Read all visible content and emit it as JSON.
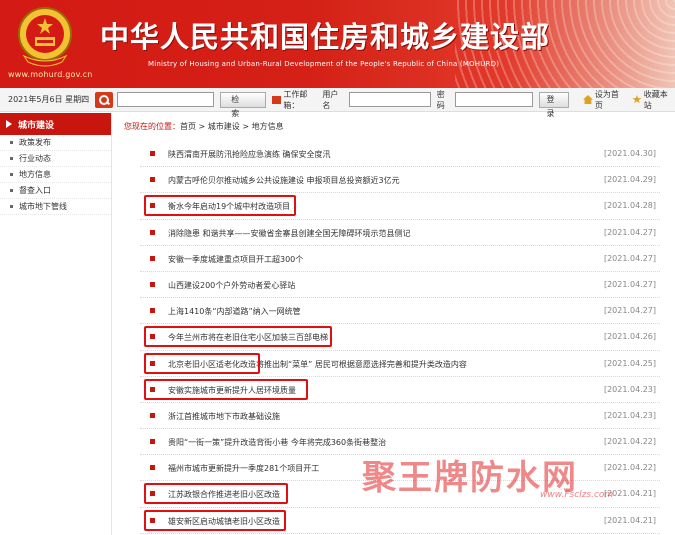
{
  "header": {
    "site_url": "www.mohurd.gov.cn",
    "title_cn": "中华人民共和国住房和城乡建设部",
    "title_en": "Ministry of Housing and Urban-Rural Development of the People's Republic of China (MOHURD)"
  },
  "toolbar": {
    "date": "2021年5月6日 星期四",
    "search_button_label": "检　索",
    "mail_label": "工作邮箱：",
    "username_label": "用户名",
    "password_label": "密码",
    "login_button_label": "登录",
    "set_home_label": "设为首页",
    "add_favorite_label": "收藏本站"
  },
  "sidebar": {
    "heading": "城市建设",
    "items": [
      {
        "label": "政策发布"
      },
      {
        "label": "行业动态"
      },
      {
        "label": "地方信息"
      },
      {
        "label": "督查入口"
      },
      {
        "label": "城市地下管线"
      }
    ]
  },
  "breadcrumb": {
    "prefix": "您现在的位置：",
    "path": "首页 > 城市建设 > 地方信息"
  },
  "news": [
    {
      "title": "陕西渭南开展防汛抢险应急演练 确保安全度汛",
      "date": "[2021.04.30]",
      "highlighted": false
    },
    {
      "title": "内蒙古呼伦贝尔推动城乡公共设施建设 申报项目总投资额近3亿元",
      "date": "[2021.04.29]",
      "highlighted": false
    },
    {
      "title": "衡水今年启动19个城中村改造项目",
      "date": "[2021.04.28]",
      "highlighted": true
    },
    {
      "title": "消除隐患 和谐共享——安徽省金寨县创建全国无障碍环境示范县侧记",
      "date": "[2021.04.27]",
      "highlighted": false
    },
    {
      "title": "安徽一季度城建重点项目开工超300个",
      "date": "[2021.04.27]",
      "highlighted": false
    },
    {
      "title": "山西建设200个户外劳动者爱心驿站",
      "date": "[2021.04.27]",
      "highlighted": false
    },
    {
      "title": "上海1410条“内部道路”纳入一网统管",
      "date": "[2021.04.27]",
      "highlighted": false
    },
    {
      "title": "今年兰州市将在老旧住宅小区加装三百部电梯",
      "date": "[2021.04.26]",
      "highlighted": true
    },
    {
      "title": "北京老旧小区适老化改造将推出制“菜单” 居民可根据意愿选择完善和提升类改造内容",
      "date": "[2021.04.25]",
      "highlighted": true
    },
    {
      "title": "安徽实施城市更新提升人居环境质量",
      "date": "[2021.04.23]",
      "highlighted": true
    },
    {
      "title": "浙江首推城市地下市政基础设施",
      "date": "[2021.04.23]",
      "highlighted": false
    },
    {
      "title": "贵阳“一街一策”提升改造背街小巷 今年将完成360条街巷整治",
      "date": "[2021.04.22]",
      "highlighted": false
    },
    {
      "title": "福州市城市更新提升一季度281个项目开工",
      "date": "[2021.04.22]",
      "highlighted": false
    },
    {
      "title": "江苏政银合作推进老旧小区改造",
      "date": "[2021.04.21]",
      "highlighted": true
    },
    {
      "title": "雄安新区启动城镇老旧小区改造",
      "date": "[2021.04.21]",
      "highlighted": true
    }
  ],
  "watermark": {
    "big": "聚王牌防水网",
    "small": "www.Fsclzs.com"
  },
  "colors": {
    "brand_red": "#c8160f",
    "highlight_box": "#e01010"
  }
}
